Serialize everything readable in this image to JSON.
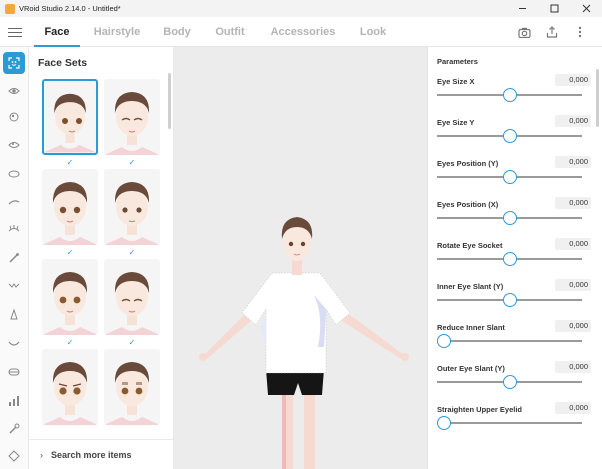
{
  "window": {
    "title": "VRoid Studio 2.14.0 - Untitled*"
  },
  "nav": {
    "tabs": [
      {
        "label": "Face",
        "active": true
      },
      {
        "label": "Hairstyle",
        "active": false
      },
      {
        "label": "Body",
        "active": false
      },
      {
        "label": "Outfit",
        "active": false
      },
      {
        "label": "Accessories",
        "active": false
      },
      {
        "label": "Look",
        "active": false
      }
    ],
    "icons": [
      "camera-icon",
      "export-icon",
      "more-vertical-icon"
    ]
  },
  "rail": {
    "items": [
      "face-sets-icon",
      "eye-icon",
      "iris-icon",
      "eye-highlight-icon",
      "eye-white-icon",
      "eyebrow-icon",
      "eyelash-icon",
      "eyeline-icon",
      "eye-shadow-icon",
      "nose-icon",
      "mouth-icon",
      "teeth-icon",
      "ear-icon",
      "makeup-icon",
      "face-outline-icon"
    ]
  },
  "facesets": {
    "title": "Face Sets",
    "search_more": "Search more items"
  },
  "params": {
    "title": "Parameters",
    "items": [
      {
        "label": "Eye Size X",
        "value": "0,000",
        "level": 0.5
      },
      {
        "label": "Eye Size Y",
        "value": "0,000",
        "level": 0.5
      },
      {
        "label": "Eyes Position (Y)",
        "value": "0,000",
        "level": 0.5
      },
      {
        "label": "Eyes Position (X)",
        "value": "0,000",
        "level": 0.5
      },
      {
        "label": "Rotate Eye Socket",
        "value": "0,000",
        "level": 0.5
      },
      {
        "label": "Inner Eye Slant (Y)",
        "value": "0,000",
        "level": 0.5
      },
      {
        "label": "Reduce Inner Slant",
        "value": "0,000",
        "level": 0.0
      },
      {
        "label": "Outer Eye Slant (Y)",
        "value": "0,000",
        "level": 0.5
      },
      {
        "label": "Straighten Upper Eyelid",
        "value": "0,000",
        "level": 0.0
      }
    ]
  },
  "colors": {
    "accent": "#2b9bd6",
    "viewport_bg": "#ececec"
  }
}
